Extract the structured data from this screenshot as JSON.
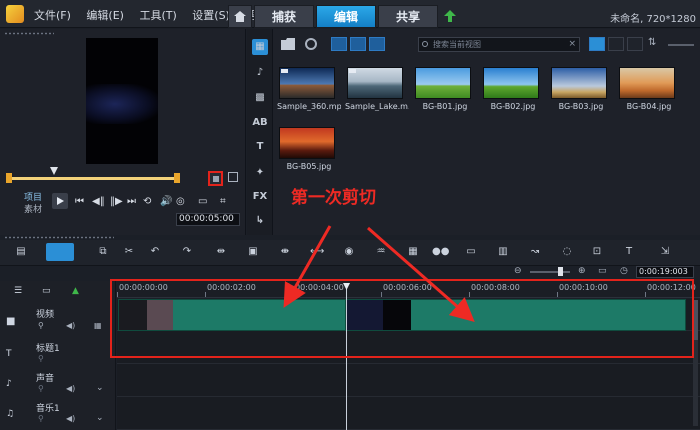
{
  "menu": [
    "文件(F)",
    "编辑(E)",
    "工具(T)",
    "设置(S)",
    "帮助"
  ],
  "tabs": {
    "capture": "捕获",
    "edit": "编辑",
    "share": "共享"
  },
  "status": "未命名, 720*1280",
  "preview": {
    "mode_project": "项目",
    "mode_clip": "素材",
    "timecode": "00:00:05:00"
  },
  "library": {
    "search_placeholder": "搜索当前视图",
    "items": [
      {
        "label": "Sample_360.mp4"
      },
      {
        "label": "Sample_Lake.m..."
      },
      {
        "label": "BG-B01.jpg"
      },
      {
        "label": "BG-B02.jpg"
      },
      {
        "label": "BG-B03.jpg"
      },
      {
        "label": "BG-B04.jpg"
      },
      {
        "label": "BG-B05.jpg"
      }
    ],
    "side_labels": {
      "fx": "FX",
      "title": "T"
    }
  },
  "annotation": "第一次剪切",
  "timeline": {
    "zoom_timecode": "0:00:19:003",
    "ruler": [
      "00:00:00:00",
      "00:00:02:00",
      "00:00:04:00",
      "00:00:06:00",
      "00:00:08:00",
      "00:00:10:00",
      "00:00:12:00"
    ],
    "tracks": [
      {
        "label": "视频"
      },
      {
        "label": "标题1"
      },
      {
        "label": "声音"
      },
      {
        "label": "音乐1"
      }
    ]
  },
  "colors": {
    "accent": "#2ba8e8",
    "highlight": "#e3231b",
    "clip": "#1d7a67"
  }
}
